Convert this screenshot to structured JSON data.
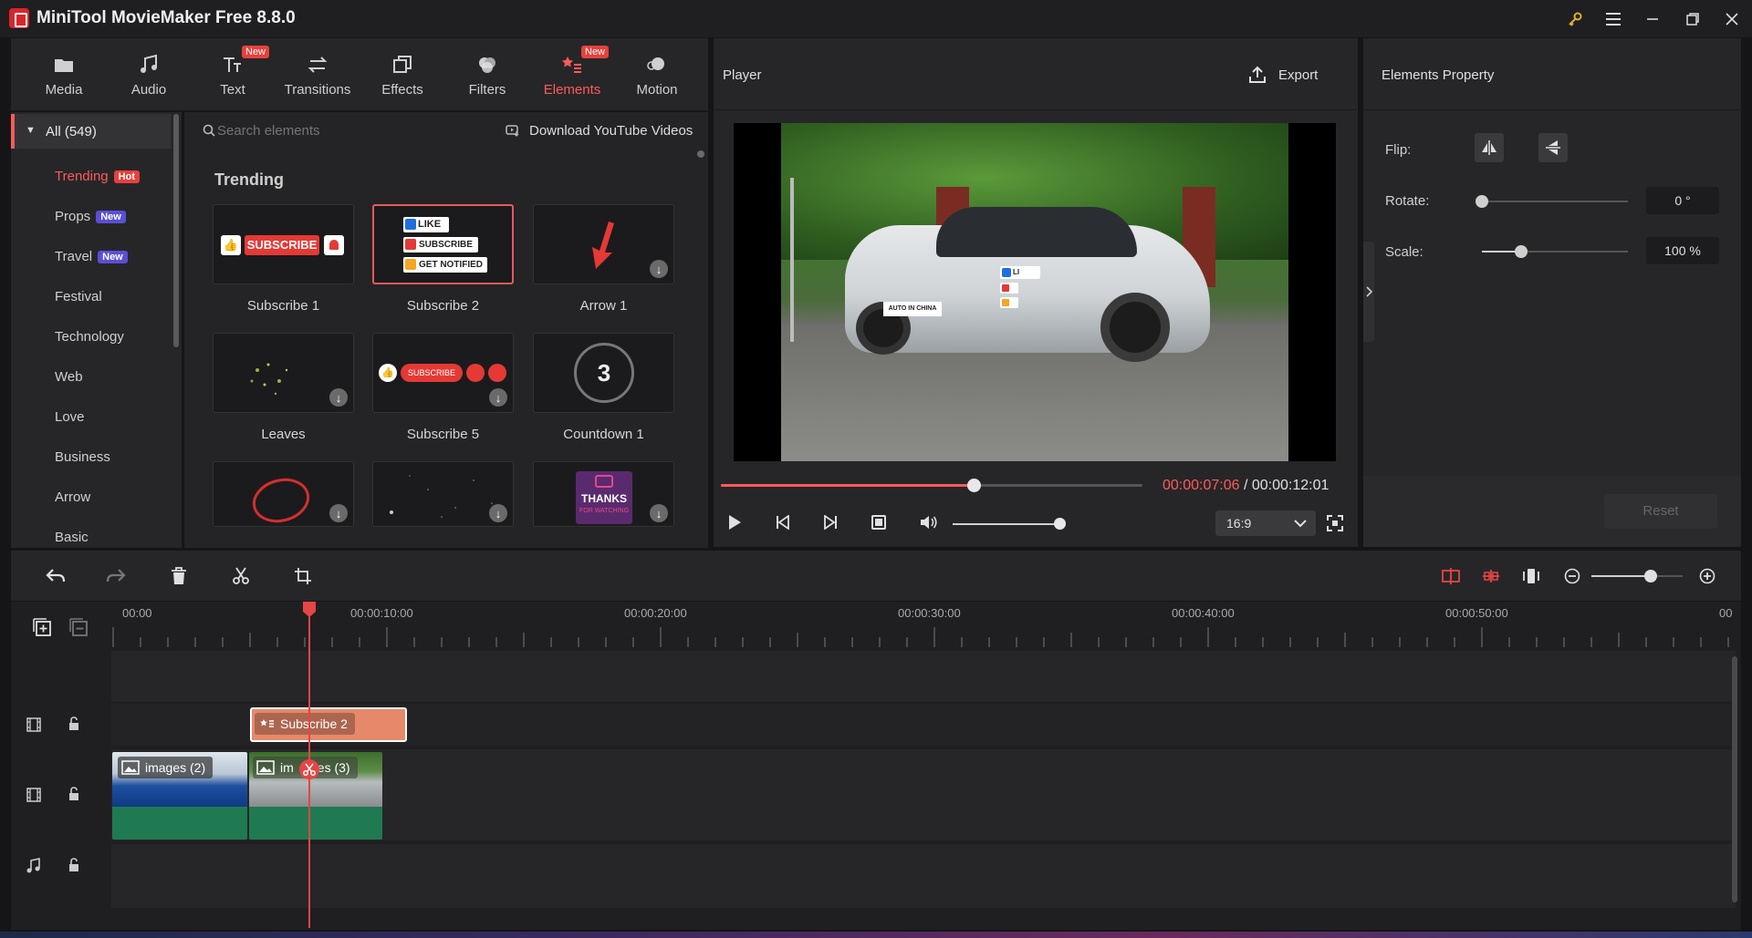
{
  "app": {
    "title": "MiniTool MovieMaker Free 8.8.0"
  },
  "toolbar": {
    "tabs": [
      {
        "label": "Media",
        "icon": "media-icon"
      },
      {
        "label": "Audio",
        "icon": "audio-icon"
      },
      {
        "label": "Text",
        "icon": "text-icon",
        "badge": "New"
      },
      {
        "label": "Transitions",
        "icon": "transitions-icon"
      },
      {
        "label": "Effects",
        "icon": "effects-icon"
      },
      {
        "label": "Filters",
        "icon": "filters-icon"
      },
      {
        "label": "Elements",
        "icon": "elements-icon",
        "badge": "New",
        "active": true
      },
      {
        "label": "Motion",
        "icon": "motion-icon"
      }
    ]
  },
  "categories": {
    "all_label": "All (549)",
    "items": [
      {
        "label": "Trending",
        "badge": "Hot",
        "badge_color": "#e8403c",
        "active": true
      },
      {
        "label": "Props",
        "badge": "New",
        "badge_color": "#5a4fd6"
      },
      {
        "label": "Travel",
        "badge": "New",
        "badge_color": "#5a4fd6"
      },
      {
        "label": "Festival"
      },
      {
        "label": "Technology"
      },
      {
        "label": "Web"
      },
      {
        "label": "Love"
      },
      {
        "label": "Business"
      },
      {
        "label": "Arrow"
      },
      {
        "label": "Basic"
      }
    ]
  },
  "elements_grid": {
    "search_placeholder": "Search elements",
    "download_label": "Download YouTube Videos",
    "section_title": "Trending",
    "items": [
      {
        "label": "Subscribe 1"
      },
      {
        "label": "Subscribe 2"
      },
      {
        "label": "Arrow 1"
      },
      {
        "label": "Leaves"
      },
      {
        "label": "Subscribe 5"
      },
      {
        "label": "Countdown 1"
      }
    ],
    "thumb_texts": {
      "subscribe": "SUBSCRIBE",
      "like": "LIKE",
      "subscribe_caps": "SUBSCRIBE",
      "get_notified": "GET NOTIFIED",
      "subscribe_small": "SUBSCRIBE",
      "countdown": "3",
      "thanks": "THANKS",
      "for_watching": "FOR WATCHING"
    }
  },
  "player": {
    "title": "Player",
    "export_label": "Export",
    "current_time": "00:00:07:06",
    "separator": " / ",
    "total_time": "00:00:12:01",
    "progress": 0.6,
    "volume": 1.0,
    "aspect_ratio": "16:9",
    "overlay_texts": {
      "plate": "AUTO IN CHINA",
      "like": "LI"
    }
  },
  "properties": {
    "title": "Elements Property",
    "flip_label": "Flip:",
    "rotate_label": "Rotate:",
    "rotate_value": "0 °",
    "rotate_fraction": 0.0,
    "scale_label": "Scale:",
    "scale_value": "100 %",
    "scale_fraction": 0.27,
    "reset_label": "Reset"
  },
  "timeline": {
    "ruler_labels": [
      "00:00",
      "00:00:10:00",
      "00:00:20:00",
      "00:00:30:00",
      "00:00:40:00",
      "00:00:50:00",
      "00"
    ],
    "zoom_level": 0.65,
    "clips": {
      "element_clip": "Subscribe 2",
      "video_clip_1": "images (2)",
      "video_clip_2_left": "im",
      "video_clip_2_right": "es (3)"
    }
  },
  "colors": {
    "accent": "#ff5a5a",
    "playhead": "#e64545",
    "element_clip": "#e6896a",
    "video_clip_green": "#1f7a52"
  }
}
